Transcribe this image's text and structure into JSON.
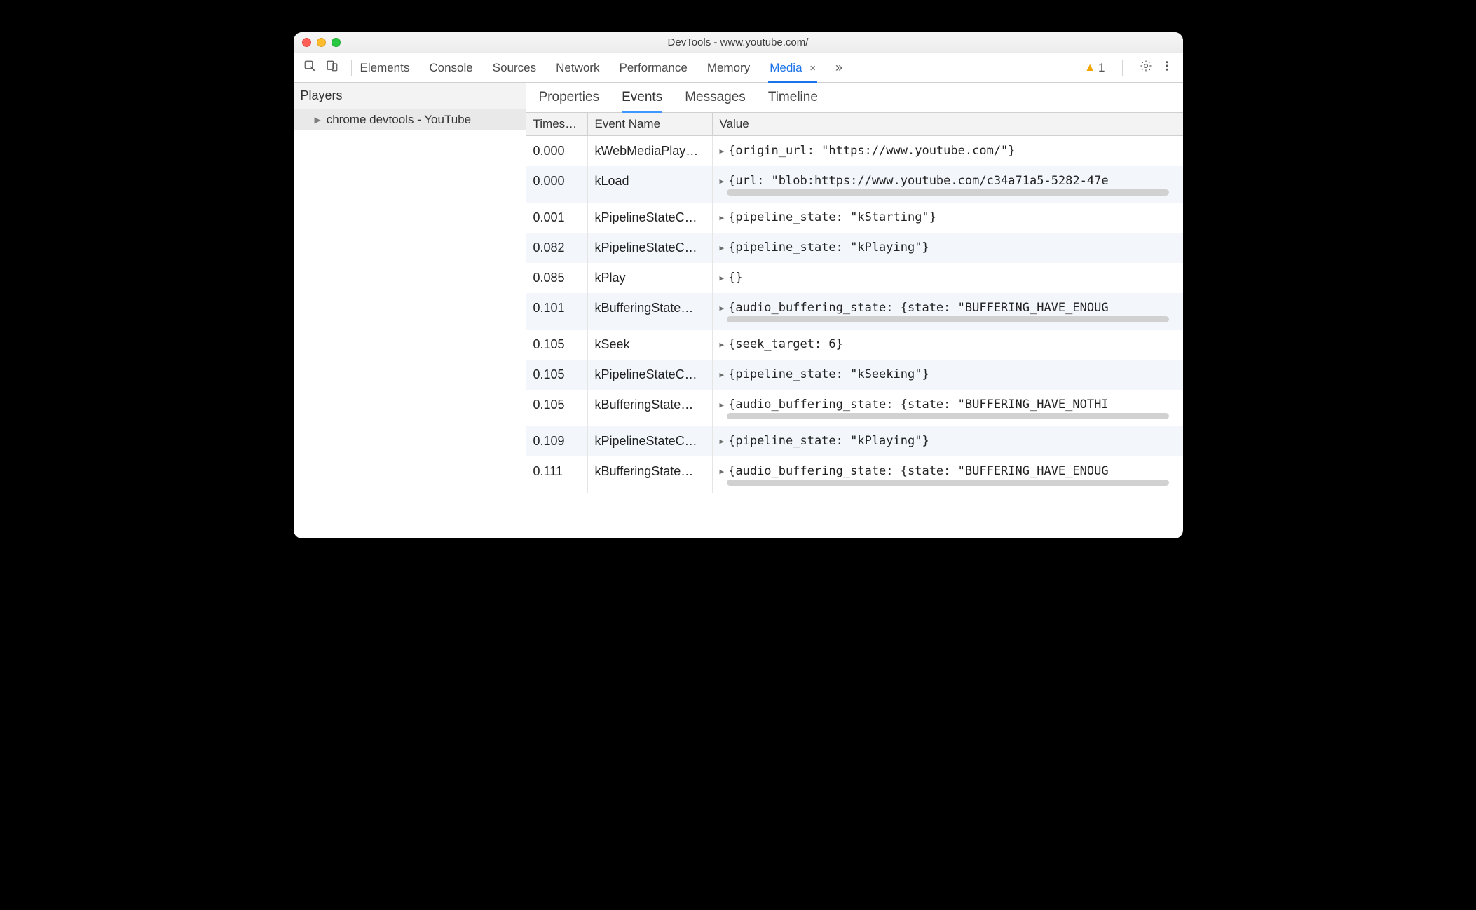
{
  "window": {
    "title": "DevTools - www.youtube.com/"
  },
  "toolbar": {
    "tabs": [
      "Elements",
      "Console",
      "Sources",
      "Network",
      "Performance",
      "Memory",
      "Media"
    ],
    "active_tab": "Media",
    "warning_count": "1"
  },
  "sidebar": {
    "header": "Players",
    "items": [
      "chrome devtools - YouTube"
    ]
  },
  "subtabs": {
    "items": [
      "Properties",
      "Events",
      "Messages",
      "Timeline"
    ],
    "active": "Events"
  },
  "table": {
    "headers": [
      "Times…",
      "Event Name",
      "Value"
    ],
    "rows": [
      {
        "ts": "0.000",
        "name": "kWebMediaPlay…",
        "value": "{origin_url: \"https://www.youtube.com/\"}",
        "overflow": false
      },
      {
        "ts": "0.000",
        "name": "kLoad",
        "value": "{url: \"blob:https://www.youtube.com/c34a71a5-5282-47e",
        "overflow": true
      },
      {
        "ts": "0.001",
        "name": "kPipelineStateC…",
        "value": "{pipeline_state: \"kStarting\"}",
        "overflow": false
      },
      {
        "ts": "0.082",
        "name": "kPipelineStateC…",
        "value": "{pipeline_state: \"kPlaying\"}",
        "overflow": false
      },
      {
        "ts": "0.085",
        "name": "kPlay",
        "value": "{}",
        "overflow": false
      },
      {
        "ts": "0.101",
        "name": "kBufferingState…",
        "value": "{audio_buffering_state: {state: \"BUFFERING_HAVE_ENOUG",
        "overflow": true
      },
      {
        "ts": "0.105",
        "name": "kSeek",
        "value": "{seek_target: 6}",
        "overflow": false
      },
      {
        "ts": "0.105",
        "name": "kPipelineStateC…",
        "value": "{pipeline_state: \"kSeeking\"}",
        "overflow": false
      },
      {
        "ts": "0.105",
        "name": "kBufferingState…",
        "value": "{audio_buffering_state: {state: \"BUFFERING_HAVE_NOTHI",
        "overflow": true
      },
      {
        "ts": "0.109",
        "name": "kPipelineStateC…",
        "value": "{pipeline_state: \"kPlaying\"}",
        "overflow": false
      },
      {
        "ts": "0.111",
        "name": "kBufferingState…",
        "value": "{audio_buffering_state: {state: \"BUFFERING_HAVE_ENOUG",
        "overflow": true
      }
    ]
  }
}
